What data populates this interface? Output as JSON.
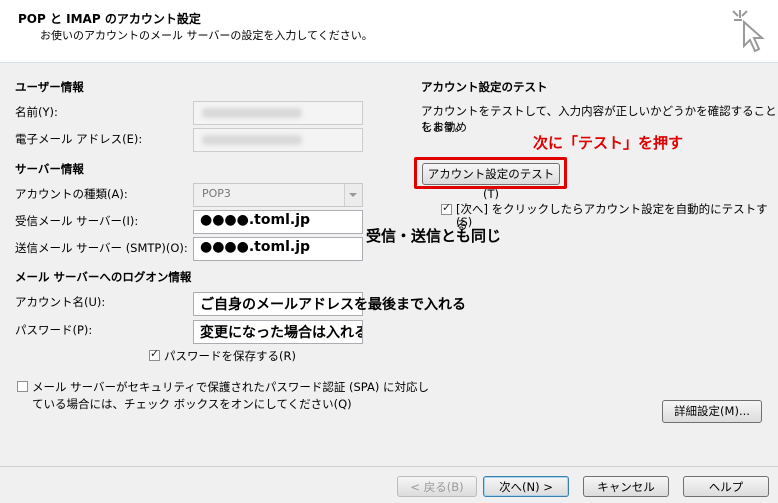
{
  "header": {
    "title": "POP と IMAP のアカウント設定",
    "subtitle": "お使いのアカウントのメール サーバーの設定を入力してください。"
  },
  "user_info": {
    "section": "ユーザー情報",
    "name_label": "名前(Y):",
    "email_label": "電子メール アドレス(E):"
  },
  "server_info": {
    "section": "サーバー情報",
    "account_type_label": "アカウントの種類(A):",
    "account_type_value": "POP3",
    "incoming_label": "受信メール サーバー(I):",
    "incoming_value": "●●●●.toml.jp",
    "outgoing_label": "送信メール サーバー (SMTP)(O):",
    "outgoing_value": "●●●●.toml.jp",
    "same_note": "受信・送信とも同じ"
  },
  "logon": {
    "section": "メール サーバーへのログオン情報",
    "account_label": "アカウント名(U):",
    "account_value": "ご自身のメールアドレスを最後まで入れる",
    "password_label": "パスワード(P):",
    "password_value": "変更になった場合は入れる",
    "save_password_label": "パスワードを保存する(R)",
    "spa_label_line1": "メール サーバーがセキュリティで保護されたパスワード認証 (SPA) に対応し",
    "spa_label_line2": "ている場合には、チェック ボックスをオンにしてください(Q)"
  },
  "test": {
    "section": "アカウント設定のテスト",
    "desc_line1": "アカウントをテストして、入力内容が正しいかどうかを確認することをお勧め",
    "desc_line2": "します。",
    "annotation": "次に「テスト」を押す",
    "test_button": "アカウント設定のテスト(T)",
    "auto_test_line1": "[次へ] をクリックしたらアカウント設定を自動的にテストする",
    "auto_test_line2": "(S)"
  },
  "buttons": {
    "advanced": "詳細設定(M)...",
    "back": "< 戻る(B)",
    "next": "次へ(N) >",
    "cancel": "キャンセル",
    "help": "ヘルプ"
  }
}
